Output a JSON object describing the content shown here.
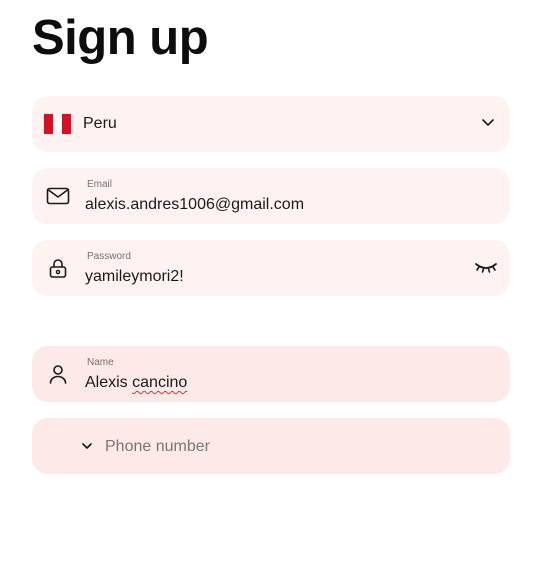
{
  "page": {
    "title": "Sign up"
  },
  "country": {
    "label": "Peru",
    "flag_icon": "peru-flag-icon",
    "expand_icon": "chevron-down-icon"
  },
  "email": {
    "label": "Email",
    "value": "alexis.andres1006@gmail.com",
    "icon": "envelope-icon"
  },
  "password": {
    "label": "Password",
    "value": "yamileymori2!",
    "icon": "lock-icon",
    "toggle_icon": "eye-closed-icon"
  },
  "name": {
    "label": "Name",
    "first": "Alexis",
    "last": "cancino",
    "icon": "user-icon"
  },
  "phone": {
    "placeholder": "Phone number",
    "expand_icon": "chevron-down-icon"
  },
  "colors": {
    "field_bg": "#fff3f2",
    "field_filled_bg": "#fde9e7",
    "flag_red": "#d91023",
    "spellcheck": "#e03030"
  }
}
